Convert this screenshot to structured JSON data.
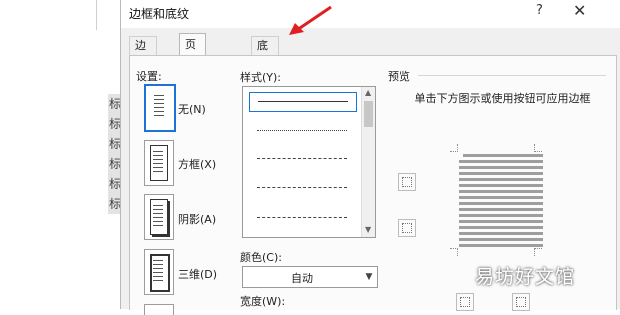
{
  "document": {
    "line_text": "标",
    "line_count": 6
  },
  "dialog": {
    "title": "边框和底纹",
    "help": "?",
    "close": "✕",
    "tabs": [
      "边框(B)",
      "页面边框(P)",
      "底纹(S)"
    ],
    "active_tab": 1
  },
  "settings": {
    "label": "设置:",
    "items": [
      "无(N)",
      "方框(X)",
      "阴影(A)",
      "三维(D)"
    ],
    "selected": 0
  },
  "style": {
    "label": "样式(Y):",
    "items": [
      "solid",
      "dotted-fine",
      "dashed-fine",
      "dashed",
      "dashed-long"
    ],
    "selected": 0
  },
  "color": {
    "label": "颜色(C):",
    "value": "自动"
  },
  "width": {
    "label": "宽度(W):"
  },
  "preview": {
    "label": "预览",
    "hint": "单击下方图示或使用按钮可应用边框"
  },
  "watermark": "易坊好文馆",
  "colors": {
    "accent": "#1a73d9",
    "arrow": "#e02020"
  }
}
